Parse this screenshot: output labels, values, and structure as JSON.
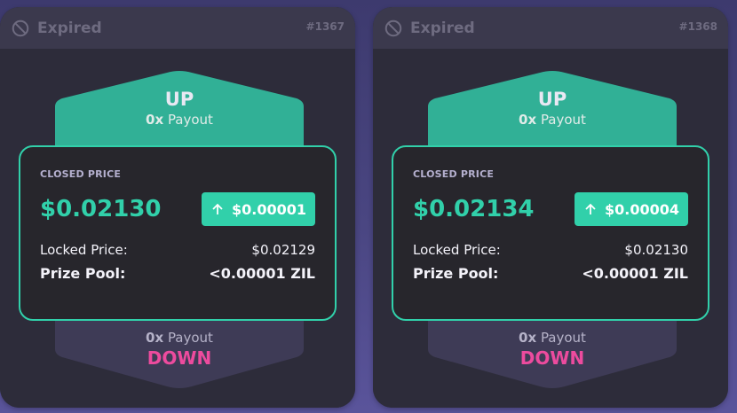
{
  "cards": [
    {
      "status": "Expired",
      "epoch": "#1367",
      "up_label": "UP",
      "up_payout_mult": "0x",
      "up_payout_word": "Payout",
      "closed_label": "CLOSED PRICE",
      "closed_price": "$0.02130",
      "price_diff": "$0.00001",
      "locked_label": "Locked Price:",
      "locked_price": "$0.02129",
      "prize_label": "Prize Pool:",
      "prize_value": "<0.00001 ZIL",
      "down_payout_mult": "0x",
      "down_payout_word": "Payout",
      "down_label": "DOWN"
    },
    {
      "status": "Expired",
      "epoch": "#1368",
      "up_label": "UP",
      "up_payout_mult": "0x",
      "up_payout_word": "Payout",
      "closed_label": "CLOSED PRICE",
      "closed_price": "$0.02134",
      "price_diff": "$0.00004",
      "locked_label": "Locked Price:",
      "locked_price": "$0.02130",
      "prize_label": "Prize Pool:",
      "prize_value": "<0.00001 ZIL",
      "down_payout_mult": "0x",
      "down_payout_word": "Payout",
      "down_label": "DOWN"
    }
  ],
  "icons": {
    "status": "block-icon",
    "diff": "arrow-up-icon"
  },
  "colors": {
    "accent_up": "#31d0aa",
    "accent_down": "#ed4b9e",
    "card_bg": "#27262c",
    "header_bg": "#3b394d"
  }
}
